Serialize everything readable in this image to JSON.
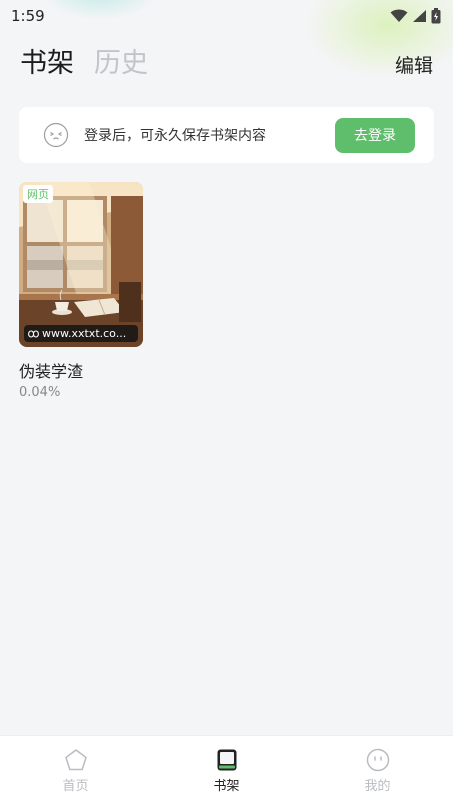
{
  "status_bar": {
    "time": "1:59"
  },
  "header": {
    "tabs": [
      {
        "label": "书架",
        "active": true
      },
      {
        "label": "历史",
        "active": false
      }
    ],
    "edit_label": "编辑"
  },
  "login_banner": {
    "icon": "face-icon",
    "message": "登录后，可永久保存书架内容",
    "button_label": "去登录"
  },
  "books": [
    {
      "badge": "网页",
      "source_url": "www.xxtxt.co...",
      "title": "伪装学渣",
      "progress": "0.04%"
    }
  ],
  "bottom_nav": {
    "items": [
      {
        "label": "首页",
        "icon": "pentagon-icon",
        "active": false
      },
      {
        "label": "书架",
        "icon": "bookshelf-icon",
        "active": true
      },
      {
        "label": "我的",
        "icon": "smiley-icon",
        "active": false
      }
    ]
  },
  "colors": {
    "accent": "#5fbe6b",
    "background": "#f4f5f7",
    "inactive_text": "#c2c4c8"
  }
}
